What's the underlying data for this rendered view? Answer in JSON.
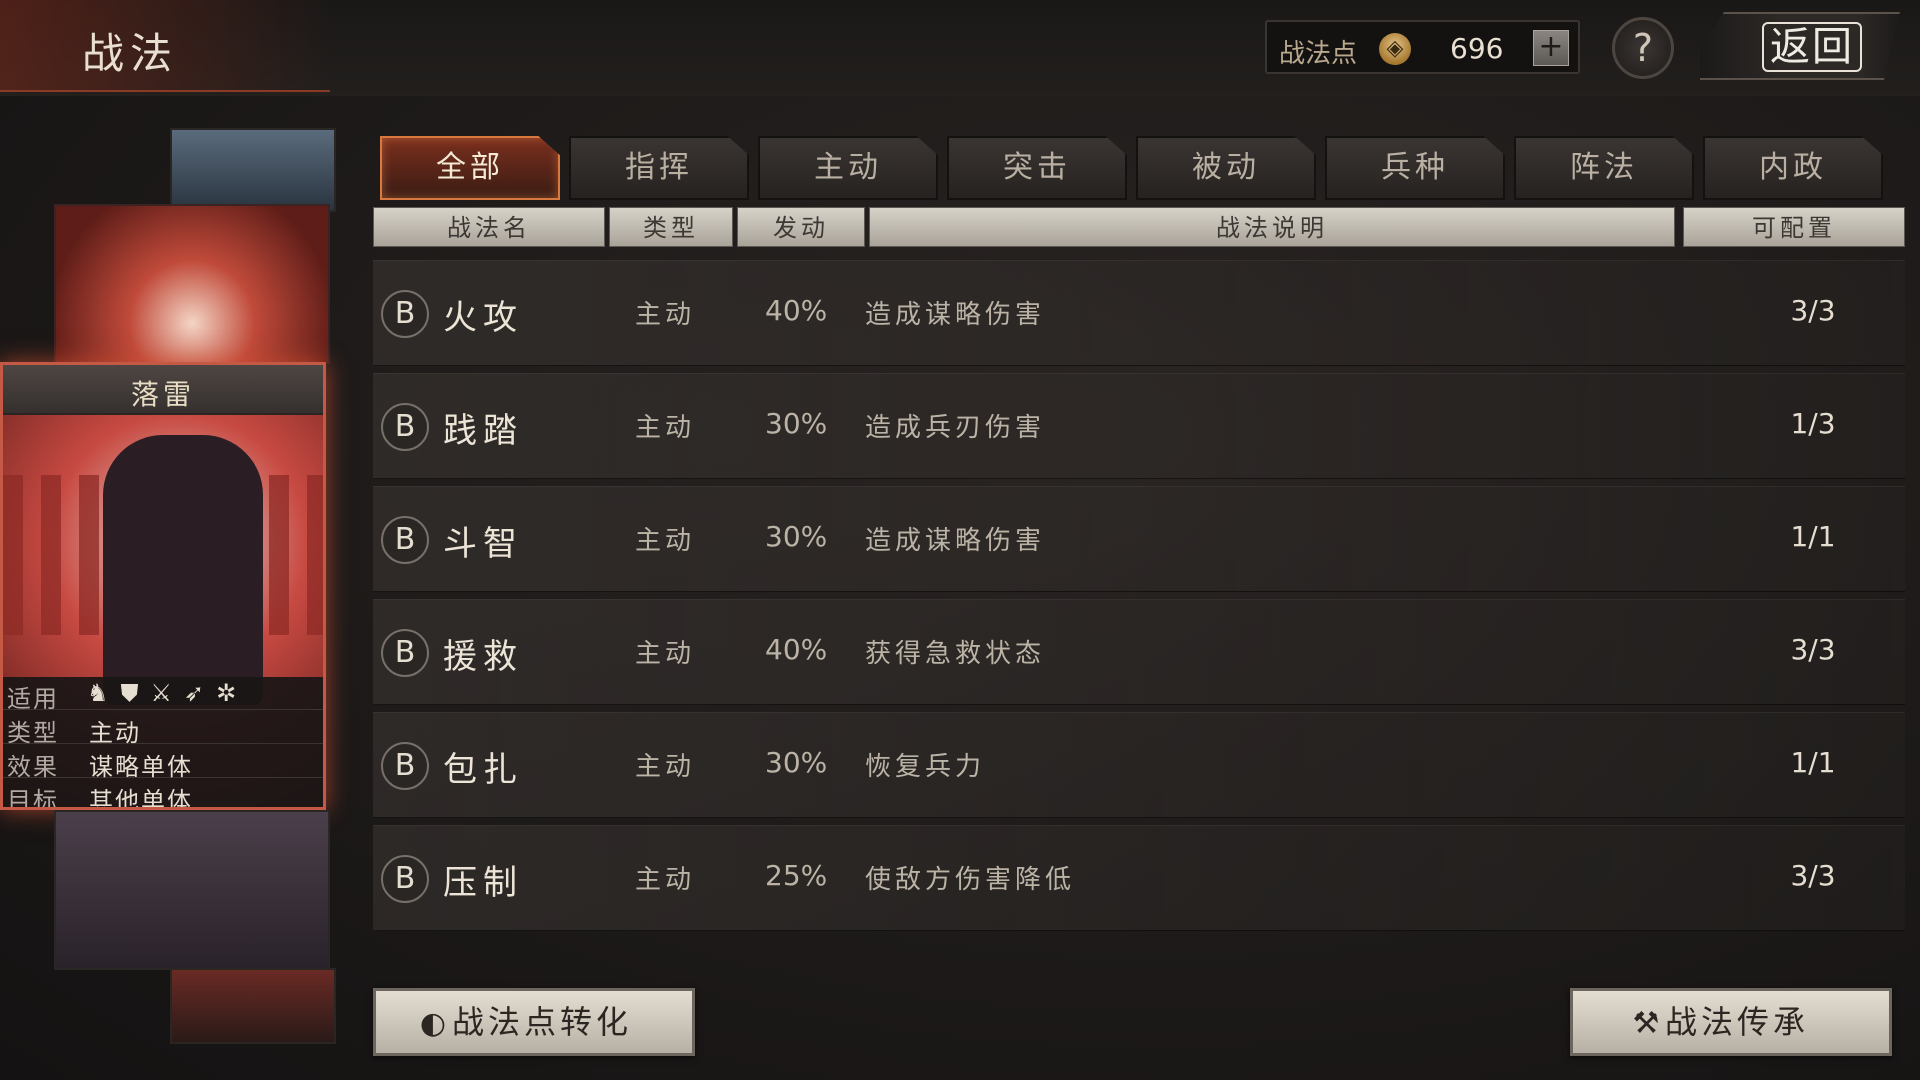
{
  "header": {
    "title": "战法",
    "points_label": "战法点",
    "points_icon": "flame-coin-icon",
    "points_value": "696",
    "plus_label": "+",
    "help_label": "?",
    "back_label": "返回"
  },
  "card": {
    "name": "落雷",
    "rows": [
      {
        "key": "适用",
        "value": ""
      },
      {
        "key": "类型",
        "value": "主动"
      },
      {
        "key": "效果",
        "value": "谋略单体"
      },
      {
        "key": "目标",
        "value": "其他单体"
      }
    ],
    "troop_icons": [
      "cavalry-icon",
      "shield-icon",
      "crossed-spears-icon",
      "bow-icon",
      "wheel-icon"
    ]
  },
  "tabs": [
    {
      "label": "全部",
      "active": true
    },
    {
      "label": "指挥",
      "active": false
    },
    {
      "label": "主动",
      "active": false
    },
    {
      "label": "突击",
      "active": false
    },
    {
      "label": "被动",
      "active": false
    },
    {
      "label": "兵种",
      "active": false
    },
    {
      "label": "阵法",
      "active": false
    },
    {
      "label": "内政",
      "active": false
    }
  ],
  "columns": [
    "战法名",
    "类型",
    "发动",
    "战法说明",
    "可配置"
  ],
  "skills": [
    {
      "grade": "B",
      "name": "火攻",
      "type": "主动",
      "rate": "40%",
      "desc": "造成谋略伤害",
      "count": "3/3"
    },
    {
      "grade": "B",
      "name": "践踏",
      "type": "主动",
      "rate": "30%",
      "desc": "造成兵刃伤害",
      "count": "1/3"
    },
    {
      "grade": "B",
      "name": "斗智",
      "type": "主动",
      "rate": "30%",
      "desc": "造成谋略伤害",
      "count": "1/1"
    },
    {
      "grade": "B",
      "name": "援救",
      "type": "主动",
      "rate": "40%",
      "desc": "获得急救状态",
      "count": "3/3"
    },
    {
      "grade": "B",
      "name": "包扎",
      "type": "主动",
      "rate": "30%",
      "desc": "恢复兵力",
      "count": "1/1"
    },
    {
      "grade": "B",
      "name": "压制",
      "type": "主动",
      "rate": "25%",
      "desc": "使敌方伤害降低",
      "count": "3/3"
    }
  ],
  "buttons": {
    "convert_label": "战法点转化",
    "inherit_label": "战法传承"
  },
  "colors": {
    "accent": "#d9783f",
    "card_glow": "#c45a45"
  }
}
